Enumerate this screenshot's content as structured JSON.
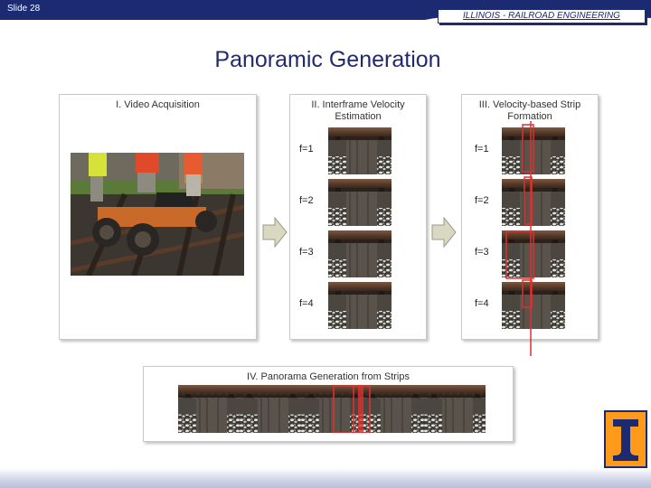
{
  "header": {
    "slide_number": "Slide 28",
    "organization": "ILLINOIS - RAILROAD ENGINEERING"
  },
  "title": "Panoramic Generation",
  "panels": {
    "acquisition": {
      "title": "I. Video Acquisition"
    },
    "velocity": {
      "title_line1": "II. Interframe Velocity",
      "title_line2": "Estimation"
    },
    "strip": {
      "title_line1": "III. Velocity-based Strip",
      "title_line2": "Formation"
    },
    "panorama": {
      "title": "IV. Panorama Generation from Strips"
    }
  },
  "frame_labels": [
    "f=1",
    "f=2",
    "f=3",
    "f=4"
  ],
  "colors": {
    "header_navy": "#1c2a72",
    "title_navy": "#222a6d",
    "strip_red": "#e0302e",
    "logo_orange": "#ff9a1a"
  },
  "icons": {
    "arrow": "process-arrow-icon",
    "logo": "rail-logo-icon"
  }
}
